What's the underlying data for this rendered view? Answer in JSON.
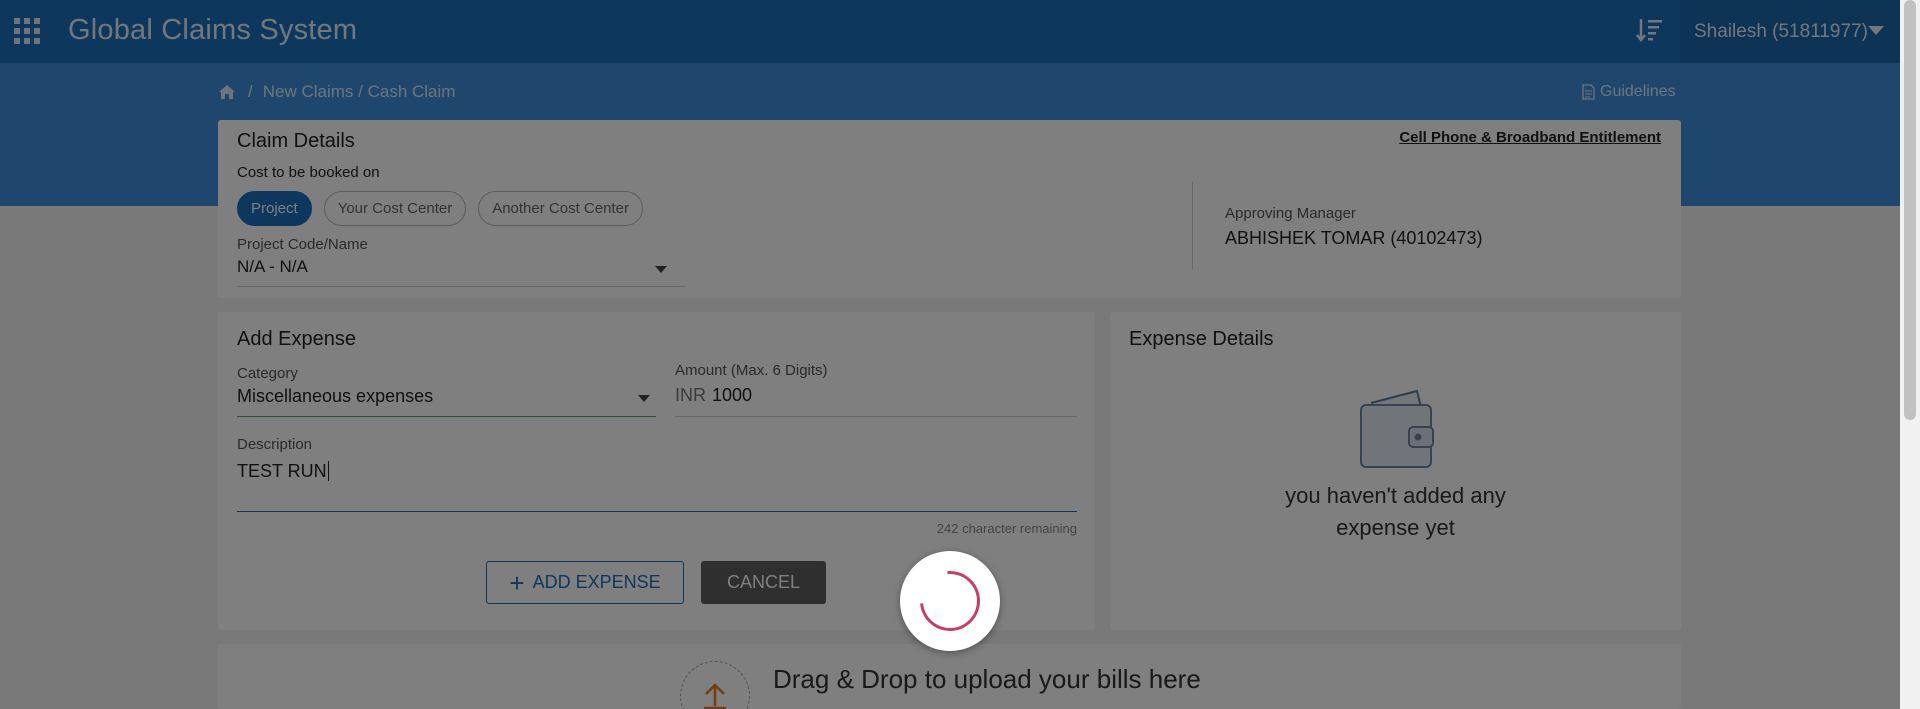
{
  "header": {
    "app_title": "Global Claims System",
    "user_label": "Shailesh (51811977)",
    "colors": {
      "primary": "#1b6fb9",
      "band": "#3e8fdc"
    }
  },
  "breadcrumb": {
    "separator": "/",
    "path": "New Claims / Cash Claim"
  },
  "guidelines_label": "Guidelines",
  "claim_details": {
    "title": "Claim Details",
    "entitlement_link": "Cell Phone & Broadband Entitlement",
    "cost_label": "Cost to be booked on",
    "options": [
      "Project",
      "Your Cost Center",
      "Another Cost Center"
    ],
    "selected_option": "Project",
    "project_label": "Project Code/Name",
    "project_value": "N/A - N/A",
    "manager_label": "Approving Manager",
    "manager_value": "ABHISHEK TOMAR (40102473)"
  },
  "add_expense": {
    "title": "Add Expense",
    "category_label": "Category",
    "category_value": "Miscellaneous expenses",
    "amount_label": "Amount (Max. 6 Digits)",
    "amount_prefix": "INR",
    "amount_value": "1000",
    "description_label": "Description",
    "description_value": "TEST RUN",
    "char_remaining": "242 character remaining",
    "add_button": "ADD EXPENSE",
    "cancel_button": "CANCEL"
  },
  "expense_details": {
    "title": "Expense Details",
    "empty_line1": "you haven't added any",
    "empty_line2": "expense yet"
  },
  "upload": {
    "text": "Drag & Drop to upload your bills here"
  },
  "icons": {
    "apps": "apps-grid-icon",
    "sort": "sort-icon",
    "home": "home-icon",
    "doc": "document-icon",
    "wallet": "wallet-icon",
    "upload": "upload-icon",
    "spinner": "loading-spinner"
  }
}
